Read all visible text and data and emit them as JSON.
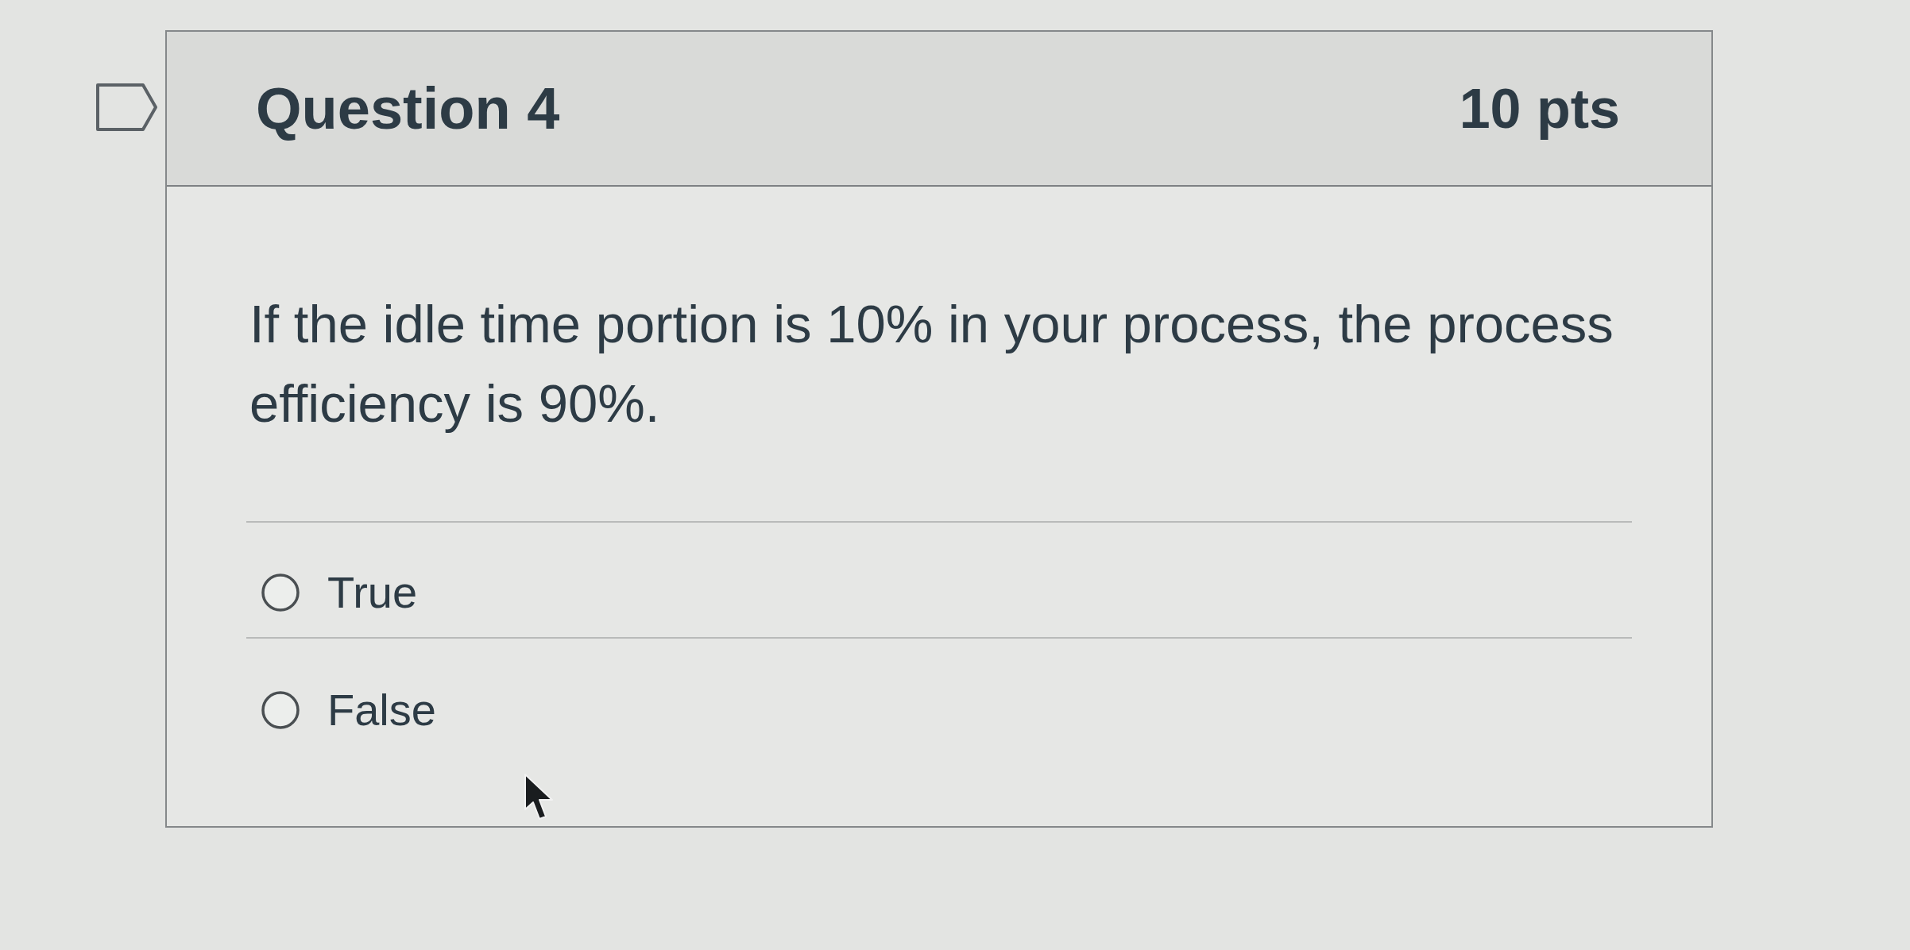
{
  "question": {
    "flagged": false,
    "title": "Question 4",
    "points": "10 pts",
    "text": "If the idle time portion is 10% in your process, the process efficiency is 90%.",
    "options": [
      {
        "label": "True",
        "selected": false
      },
      {
        "label": "False",
        "selected": false
      }
    ]
  }
}
